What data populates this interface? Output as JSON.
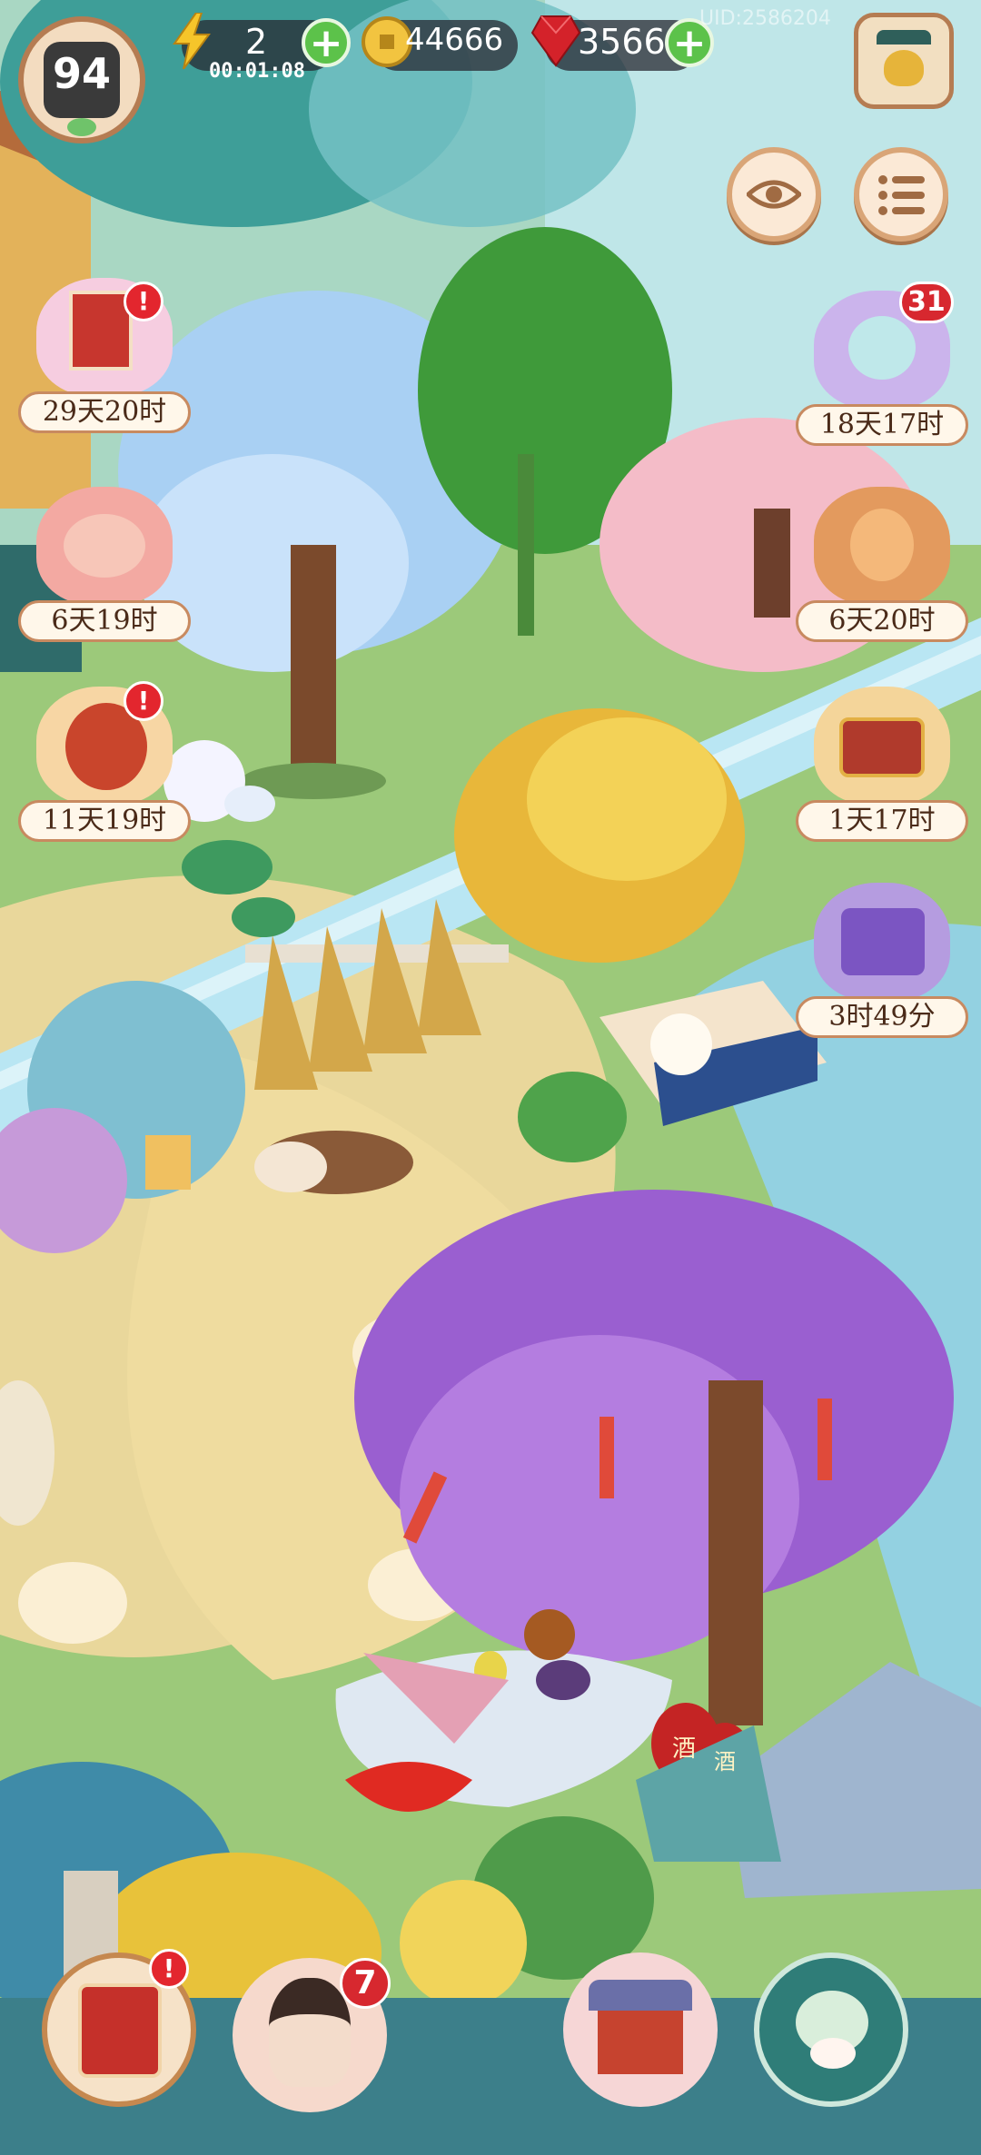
{
  "hud": {
    "level": "94",
    "energy": "2",
    "energy_timer": "00:01:08",
    "coins": "44666",
    "gems": "3566",
    "plus": "+",
    "uid_text": "UID:2586204"
  },
  "side_buttons": {
    "eye_icon": "eye-icon",
    "menu_icon": "list-menu-icon",
    "shop_icon": "golden-pot-icon"
  },
  "events_left": [
    {
      "timer": "29天20时",
      "alert": "!"
    },
    {
      "timer": "6天19时",
      "alert": ""
    },
    {
      "timer": "11天19时",
      "alert": "!"
    }
  ],
  "events_right": [
    {
      "timer": "18天17时",
      "badge": "31"
    },
    {
      "timer": "6天20时",
      "badge": ""
    },
    {
      "timer": "1天17时",
      "badge": ""
    },
    {
      "timer": "3时49分",
      "badge": ""
    }
  ],
  "bottom_bar": {
    "book_alert": "!",
    "character_badge": "7"
  },
  "scene_text": {
    "jar_label_1": "酒",
    "jar_label_2": "酒"
  },
  "colors": {
    "grass": "#9cc97a",
    "path": "#eed89a",
    "water": "#9ed8e6",
    "wisteria": "#9a5fd0",
    "blue_tree": "#a9d0f3",
    "pink_tree": "#f4bcc8",
    "alert_red": "#e3262e",
    "accent_green": "#5cc24a"
  }
}
